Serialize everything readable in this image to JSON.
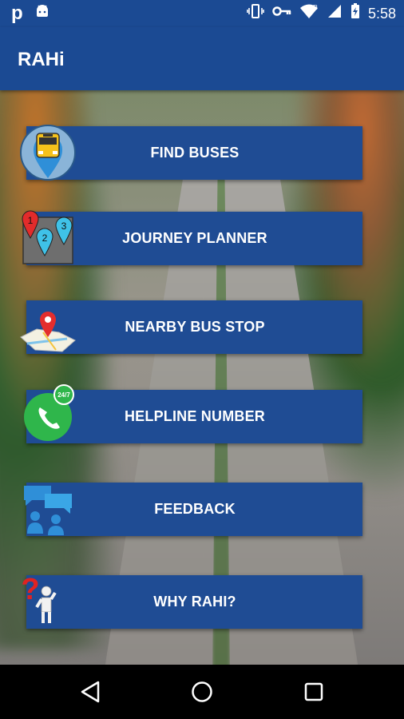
{
  "status_bar": {
    "left_icons": [
      "p-notification-icon",
      "android-debug-icon"
    ],
    "right_icons": [
      "vibrate-icon",
      "vpn-key-icon",
      "wifi-icon",
      "signal-icon",
      "battery-charging-icon"
    ],
    "time": "5:58",
    "p_glyph": "p"
  },
  "app_bar": {
    "title": "RAHi"
  },
  "menu": {
    "items": [
      {
        "label": "FIND BUSES",
        "icon": "bus-pin-icon"
      },
      {
        "label": "JOURNEY PLANNER",
        "icon": "numbered-pins-icon"
      },
      {
        "label": "NEARBY BUS STOP",
        "icon": "map-pin-icon"
      },
      {
        "label": "HELPLINE NUMBER",
        "icon": "phone-24-7-icon"
      },
      {
        "label": "FEEDBACK",
        "icon": "feedback-chat-icon"
      },
      {
        "label": "WHY RAHI?",
        "icon": "question-figure-icon"
      }
    ]
  },
  "icon_text": {
    "pin1": "1",
    "pin2": "2",
    "pin3": "3",
    "badge_247": "24/7"
  },
  "nav_bar": {
    "buttons": [
      "back-icon",
      "home-icon",
      "recents-icon"
    ]
  },
  "colors": {
    "primary": "#1b4a93",
    "button": "#1f4c94",
    "nav": "#000000"
  }
}
